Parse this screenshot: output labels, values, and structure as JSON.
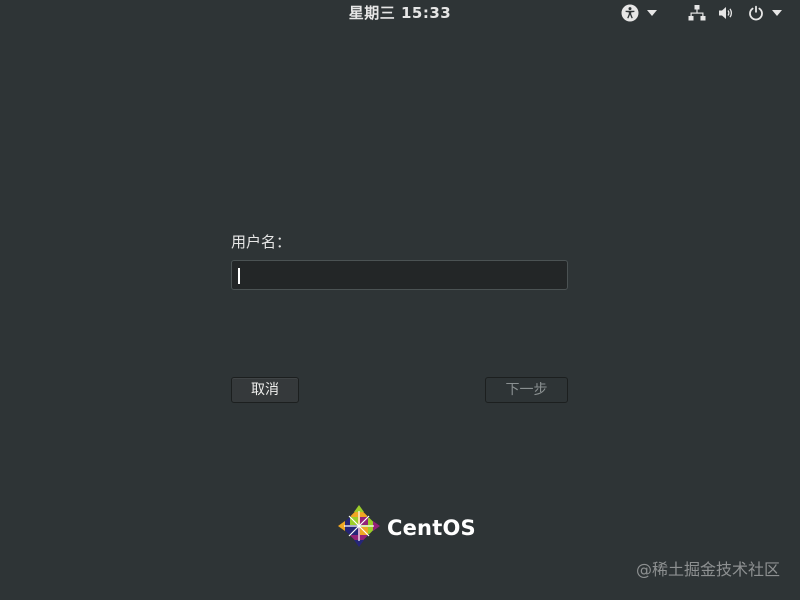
{
  "topbar": {
    "clock": "星期三 15:33",
    "accessibility_icon": "accessibility-icon",
    "network_icon": "network-wired-icon",
    "volume_icon": "volume-icon",
    "power_icon": "power-icon",
    "dropdown_icon": "chevron-down-icon"
  },
  "login": {
    "username_label": "用户名：",
    "username_value": "",
    "cancel_label": "取消",
    "next_label": "下一步"
  },
  "branding": {
    "logo_text": "CentOS",
    "logo_icon": "centos-logo-icon"
  },
  "watermark": "@稀土掘金技术社区",
  "colors": {
    "background": "#2e3436",
    "input_background": "#232627",
    "text": "#e6e6e6",
    "disabled_text": "#8a9091"
  }
}
